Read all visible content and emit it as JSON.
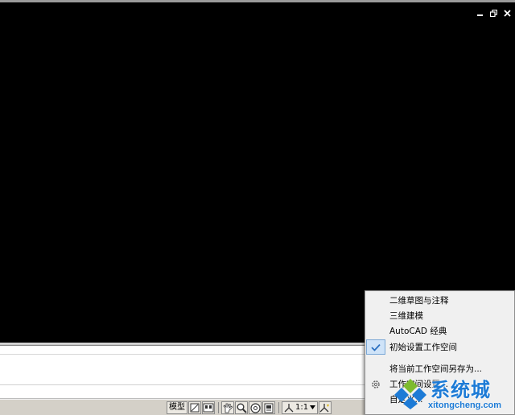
{
  "window": {
    "controls": {
      "minimize_icon": "minimize-icon",
      "restore_icon": "restore-icon",
      "close_icon": "close-icon"
    }
  },
  "command_line": {
    "value": ""
  },
  "status_bar": {
    "model_label": "模型",
    "annotation_scale": "1:1",
    "icons": [
      "layout-icon",
      "layout-icon",
      "pan-icon",
      "zoom-icon",
      "steering-wheel-icon",
      "showmotion-icon",
      "annotation-scale-icon",
      "annotation-visibility-icon",
      "workspace-switch-icon"
    ]
  },
  "workspace_menu": {
    "items": [
      {
        "label": "二维草图与注释",
        "checked": false
      },
      {
        "label": "三维建模",
        "checked": false
      },
      {
        "label": "AutoCAD 经典",
        "checked": false
      },
      {
        "label": "初始设置工作空间",
        "checked": true
      },
      {
        "label": "将当前工作空间另存为...",
        "checked": false
      },
      {
        "label": "工作空间设置...",
        "checked": false
      },
      {
        "label": "自定义...",
        "checked": false
      }
    ]
  },
  "watermark": {
    "title": "系统城",
    "url": "xitongcheng.com"
  },
  "colors": {
    "viewport_bg": "#000000",
    "menu_bg": "#f0f0f0",
    "status_bar_bg": "#d4d0c8",
    "check_color": "#2a6fc0",
    "watermark_blue": "#1d7bd6"
  }
}
